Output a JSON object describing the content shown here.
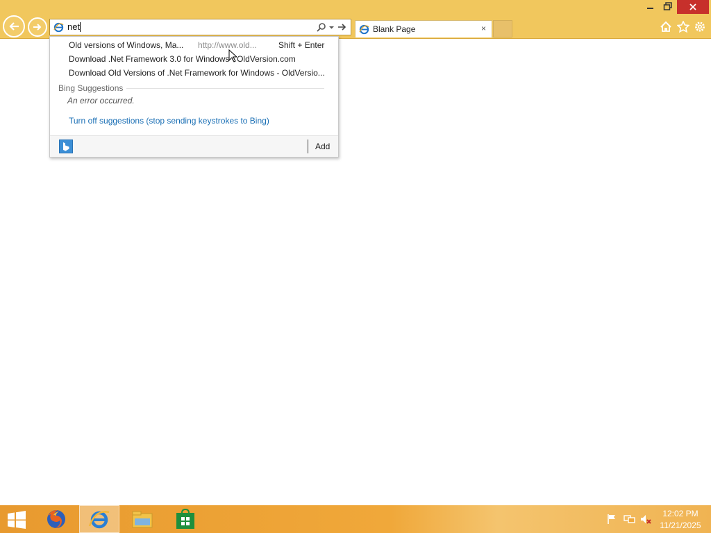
{
  "browser": {
    "address_bar": {
      "value": "net",
      "icon": "ie-page-icon",
      "search_icon": "search-icon",
      "dropdown_icon": "chevron-down-icon",
      "go_icon": "arrow-right-icon"
    },
    "tab": {
      "title": "Blank Page",
      "close": "×"
    },
    "window_controls": {
      "minimize": "minimize-icon",
      "restore": "restore-icon",
      "close": "close-icon"
    },
    "toolbar_icons": [
      "home-icon",
      "star-icon",
      "gear-icon"
    ]
  },
  "suggestions": {
    "history": [
      {
        "title": "Old versions of Windows, Ma...",
        "url": "http://www.old...",
        "hint": "Shift + Enter"
      },
      {
        "title": "Download .Net Framework 3.0 for Windows - OldVersion.com"
      },
      {
        "title": "Download Old Versions of .Net Framework for Windows - OldVersio..."
      }
    ],
    "bing_heading": "Bing Suggestions",
    "bing_error": "An error occurred.",
    "turn_off_link": "Turn off suggestions (stop sending keystrokes to Bing)",
    "footer": {
      "add_label": "Add"
    }
  },
  "taskbar": {
    "apps": [
      "windows-logo-icon",
      "firefox-icon",
      "internet-explorer-icon",
      "file-explorer-icon",
      "store-icon"
    ],
    "tray_icons": [
      "flag-icon",
      "network-icon",
      "volume-muted-icon"
    ],
    "clock": {
      "time": "12:02 PM",
      "date": "11/21/2025"
    }
  },
  "colors": {
    "chrome": "#f1c75d",
    "link": "#1a6fb5",
    "close_button": "#c7302b",
    "taskbar": "#e89a2f"
  }
}
